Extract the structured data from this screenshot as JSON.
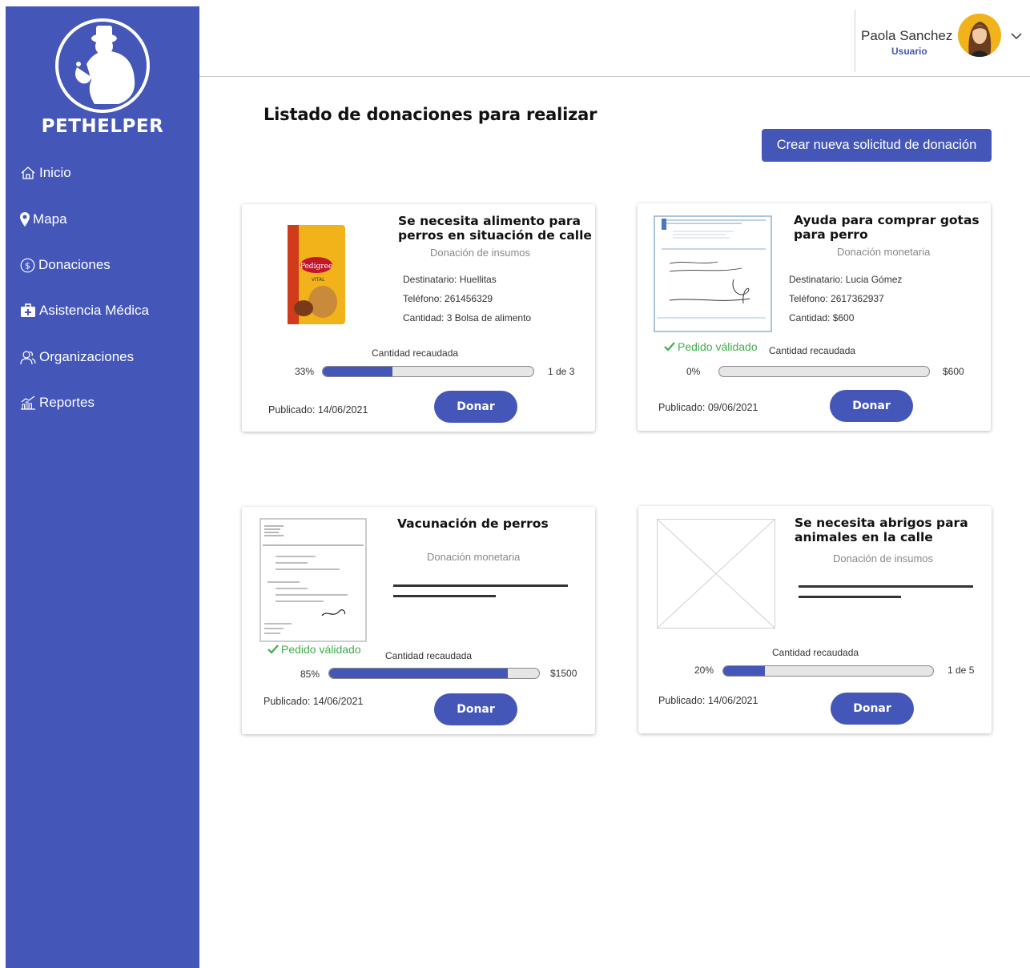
{
  "brand": {
    "name": "PETHELPER"
  },
  "sidebar": {
    "items": [
      {
        "label": "Inicio",
        "icon": "home-icon"
      },
      {
        "label": "Mapa",
        "icon": "map-pin-icon"
      },
      {
        "label": "Donaciones",
        "icon": "dollar-circle-icon"
      },
      {
        "label": "Asistencia Médica",
        "icon": "medical-kit-icon"
      },
      {
        "label": "Organizaciones",
        "icon": "users-icon"
      },
      {
        "label": "Reportes",
        "icon": "chart-icon"
      }
    ]
  },
  "user": {
    "name": "Paola Sanchez",
    "role": "Usuario"
  },
  "main": {
    "title": "Listado de donaciones para realizar",
    "create_button": "Crear nueva solicitud de donación",
    "cards": [
      {
        "title_line1": "Se necesita alimento para",
        "title_line2": "perros en situación de calle",
        "type": "Donación de insumos",
        "destinatario": "Destinatario:  Huellitas",
        "telefono": "Teléfono:  261456329",
        "cantidad": "Cantidad: 3 Bolsa de alimento",
        "recaudada_label": "Cantidad recaudada",
        "percent_text": "33%",
        "progress": 0.33,
        "goal_text": "1 de 3",
        "published": "Publicado: 14/06/2021",
        "donate": "Donar"
      },
      {
        "title_line1": "Ayuda para comprar gotas",
        "title_line2": "para perro",
        "type": "Donación monetaria",
        "destinatario": "Destinatario:  Lucia Gómez",
        "telefono": "Teléfono:  2617362937",
        "cantidad": "Cantidad: $600",
        "validated": "Pedido válidado",
        "recaudada_label": "Cantidad recaudada",
        "percent_text": "0%",
        "progress": 0.0,
        "goal_text": "$600",
        "published": "Publicado: 09/06/2021",
        "donate": "Donar"
      },
      {
        "title_line1": "Vacunación de perros",
        "type": "Donación monetaria",
        "validated": "Pedido válidado",
        "recaudada_label": "Cantidad recaudada",
        "percent_text": "85%",
        "progress": 0.85,
        "goal_text": "$1500",
        "published": "Publicado: 14/06/2021",
        "donate": "Donar"
      },
      {
        "title_line1": "Se necesita abrigos para",
        "title_line2": "animales en la calle",
        "type": "Donación de insumos",
        "recaudada_label": "Cantidad recaudada",
        "percent_text": "20%",
        "progress": 0.2,
        "goal_text": "1 de 5",
        "published": "Publicado: 14/06/2021",
        "donate": "Donar"
      }
    ]
  },
  "colors": {
    "accent": "#4457b9",
    "success": "#3fae49",
    "avatar_bg": "#f2b21a"
  }
}
